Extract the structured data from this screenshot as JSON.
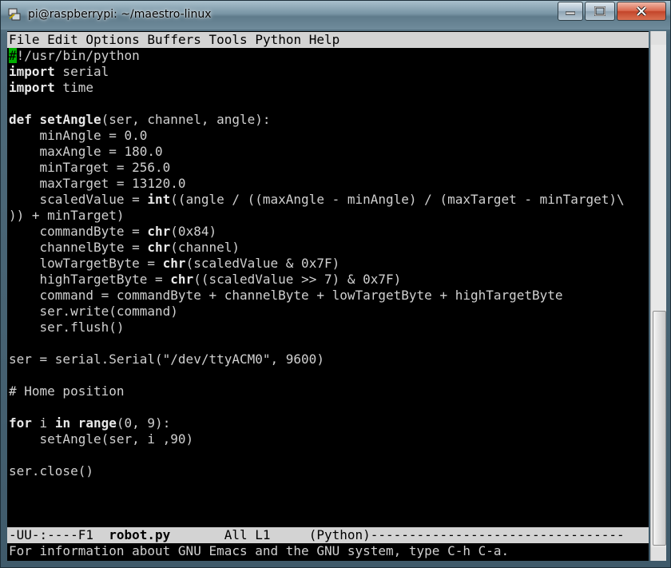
{
  "window": {
    "title": "pi@raspberrypi: ~/maestro-linux"
  },
  "menu": [
    "File",
    "Edit",
    "Options",
    "Buffers",
    "Tools",
    "Python",
    "Help"
  ],
  "code": {
    "l1_cursor": "#",
    "l1_rest": "!/usr/bin/python",
    "l2_kw": "import",
    "l2_rest": " serial",
    "l3_kw": "import",
    "l3_rest": " time",
    "l5_kw": "def",
    "l5_name": "setAngle",
    "l5_rest": "(ser, channel, angle):",
    "l6": "    minAngle = 0.0",
    "l7": "    maxAngle = 180.0",
    "l8": "    minTarget = 256.0",
    "l9": "    maxTarget = 13120.0",
    "l10_a": "    scaledValue = ",
    "l10_kw": "int",
    "l10_b": "((angle / ((maxAngle - minAngle) / (maxTarget - minTarget)\\",
    "l11": ")) + minTarget)",
    "l12_a": "    commandByte = ",
    "l12_kw": "chr",
    "l12_b": "(0x84)",
    "l13_a": "    channelByte = ",
    "l13_kw": "chr",
    "l13_b": "(channel)",
    "l14_a": "    lowTargetByte = ",
    "l14_kw": "chr",
    "l14_b": "(scaledValue & 0x7F)",
    "l15_a": "    highTargetByte = ",
    "l15_kw": "chr",
    "l15_b": "((scaledValue >> 7) & 0x7F)",
    "l16": "    command = commandByte + channelByte + lowTargetByte + highTargetByte",
    "l17": "    ser.write(command)",
    "l18": "    ser.flush()",
    "l20": "ser = serial.Serial(\"/dev/ttyACM0\", 9600)",
    "l22": "# Home position",
    "l24_kw1": "for",
    "l24_a": " i ",
    "l24_kw2": "in",
    "l24_sp": " ",
    "l24_kw3": "range",
    "l24_b": "(0, 9):",
    "l25": "    setAngle(ser, i ,90)",
    "l27": "ser.close()"
  },
  "modeline": {
    "prefix": "-UU-:----F1  ",
    "buffer": "robot.py",
    "rest": "       All L1     (Python)---------------------------------"
  },
  "echo": "For information about GNU Emacs and the GNU system, type C-h C-a.",
  "colors": {
    "terminal_bg": "#000000",
    "text": "#d0d0d0",
    "menubar_bg": "#d3d3d3",
    "cursor": "#00b000"
  }
}
